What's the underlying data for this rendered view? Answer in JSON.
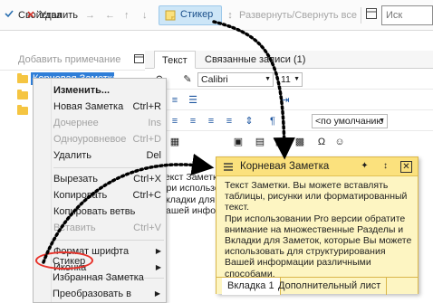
{
  "toolbar": {
    "items": [
      {
        "label": "Свойства",
        "icon": "properties-icon"
      },
      {
        "label": "Удалить",
        "icon": "delete-icon"
      },
      {
        "label": "Стикер",
        "icon": "sticker-icon"
      },
      {
        "label": "Развернуть/Свернуть все",
        "icon": "expand-collapse-icon"
      }
    ],
    "search_placeholder": "Иск"
  },
  "tree": {
    "add_note_label": "Добавить примечание",
    "root_label": "Корневая Заметка"
  },
  "context_menu": {
    "items": [
      {
        "label": "Изменить...",
        "shortcut": "",
        "disabled": false,
        "bold": true
      },
      {
        "label": "Новая Заметка",
        "shortcut": "Ctrl+R",
        "disabled": false
      },
      {
        "label": "Дочернее",
        "shortcut": "Ins",
        "disabled": true
      },
      {
        "label": "Одноуровневое",
        "shortcut": "Ctrl+D",
        "disabled": true
      },
      {
        "label": "Удалить",
        "shortcut": "Del",
        "disabled": false
      },
      {
        "label": "Вырезать",
        "shortcut": "Ctrl+X",
        "disabled": false
      },
      {
        "label": "Копировать",
        "shortcut": "Ctrl+C",
        "disabled": false
      },
      {
        "label": "Копировать ветвь",
        "shortcut": "",
        "disabled": false
      },
      {
        "label": "Вставить",
        "shortcut": "Ctrl+V",
        "disabled": true
      },
      {
        "label": "Формат шрифта",
        "shortcut": "",
        "disabled": false,
        "submenu": true
      },
      {
        "label": "Иконка",
        "shortcut": "",
        "disabled": false,
        "submenu": true
      },
      {
        "label": "Стикер",
        "shortcut": "",
        "disabled": false
      },
      {
        "label": "Избранная Заметка",
        "shortcut": "",
        "disabled": false
      },
      {
        "label": "Преобразовать в",
        "shortcut": "",
        "disabled": false,
        "submenu": true
      }
    ]
  },
  "editor": {
    "tabs": [
      "Текст",
      "Связанные записи (1)"
    ],
    "font_name": "Calibri",
    "font_size": "11",
    "paragraph_style": "<по умолчанию",
    "text_lines": [
      "Текст Заметк",
      "При использо",
      "Вкладки для",
      "Вашей инфор"
    ]
  },
  "sticker": {
    "title": "Корневая Заметка",
    "body_lines": [
      "Текст Заметки. Вы можете вставлять",
      "таблицы, рисунки или форматированный",
      "текст.",
      "При использовании Pro версии обратите",
      "внимание на множественные Разделы и",
      "Вкладки для Заметок, которые Вы можете",
      "использовать для структурирования",
      "Вашей информации различными",
      "способами."
    ],
    "tabs": [
      "Вкладка 1",
      "Дополнительный лист"
    ]
  },
  "colors": {
    "accent": "#2f7ed8",
    "sticker_bg": "#fdf5c2",
    "sticker_title": "#fbe17d",
    "highlight_ring": "#e8322a",
    "delete_red": "#d9342b"
  }
}
